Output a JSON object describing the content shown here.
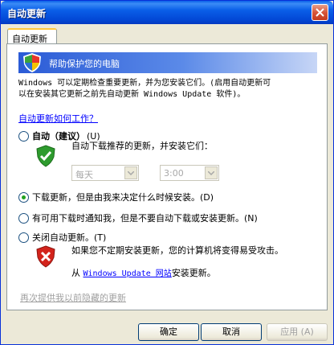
{
  "window": {
    "title": "自动更新"
  },
  "tab": {
    "label": "自动更新"
  },
  "header": {
    "title": "帮助保护您的电脑"
  },
  "description": {
    "line1": "Windows 可以定期检查重要更新，并为您安装它们。(启用自动更新可",
    "line2": "以在安装其它更新之前先自动更新 Windows Update 软件)。"
  },
  "how_link": "自动更新如何工作？",
  "options": {
    "auto": {
      "label_bold": "自动（建议）",
      "accel": "(U)",
      "sub": "自动下载推荐的更新，并安装它们：",
      "selected": false
    },
    "download": {
      "label": "下载更新，但是由我来决定什么时候安装。(D)",
      "selected": true
    },
    "notify": {
      "label": "有可用下载时通知我，但是不要自动下载或安装更新。(N)",
      "selected": false
    },
    "off": {
      "label": "关闭自动更新。(T)",
      "selected": false,
      "sub1": "如果您不定期安装更新，您的计算机将变得易受攻击。",
      "sub2_prefix": "从",
      "sub2_link": "Windows Update 网站",
      "sub2_suffix": "安装更新。"
    }
  },
  "schedule": {
    "day": "每天",
    "time": "3:00"
  },
  "hidden_link": "再次提供我以前隐藏的更新",
  "buttons": {
    "ok": "确定",
    "cancel": "取消",
    "apply": "应用 (A)"
  },
  "colors": {
    "accent": "#0a5fe8",
    "link": "#0000ff",
    "radio_dot": "#21a121"
  }
}
